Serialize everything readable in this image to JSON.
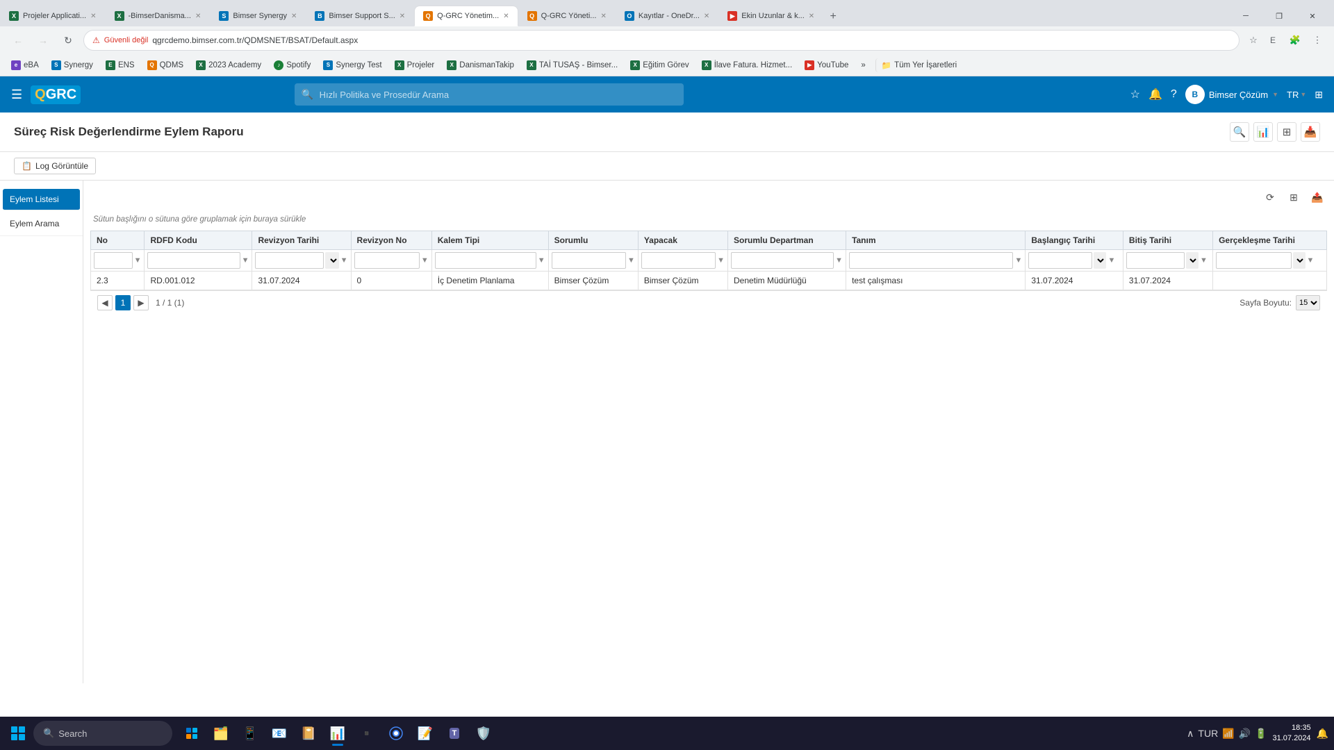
{
  "browser": {
    "tabs": [
      {
        "id": "tab1",
        "label": "Projeler Applicati...",
        "favicon_color": "#1d6f42",
        "active": false
      },
      {
        "id": "tab2",
        "label": "-BimserDanisma...",
        "favicon_color": "#1d6f42",
        "active": false
      },
      {
        "id": "tab3",
        "label": "Bimser Synergy",
        "favicon_color": "#0073b7",
        "active": false
      },
      {
        "id": "tab4",
        "label": "Bimser Support S...",
        "favicon_color": "#0073b7",
        "active": false
      },
      {
        "id": "tab5",
        "label": "Q-GRC Yönetim...",
        "favicon_color": "#e37400",
        "active": true
      },
      {
        "id": "tab6",
        "label": "Q-GRC Yöneti...",
        "favicon_color": "#e37400",
        "active": false
      },
      {
        "id": "tab7",
        "label": "Kayıtlar - OneDr...",
        "favicon_color": "#0073b7",
        "active": false
      },
      {
        "id": "tab8",
        "label": "Ekin Uzunlar & k...",
        "favicon_color": "#d93025",
        "active": false
      }
    ],
    "address": "qgrcdemo.bimser.com.tr/QDMSNET/BSAT/Default.aspx",
    "not_secure_label": "Güvenli değil"
  },
  "bookmarks": [
    {
      "label": "eBA",
      "color": "#6f42c1"
    },
    {
      "label": "Synergy",
      "color": "#0073b7"
    },
    {
      "label": "ENS",
      "color": "#1d6f42"
    },
    {
      "label": "QDMS",
      "color": "#e37400"
    },
    {
      "label": "2023 Academy",
      "color": "#1d6f42"
    },
    {
      "label": "Spotify",
      "color": "#1a7f37"
    },
    {
      "label": "Synergy Test",
      "color": "#0073b7"
    },
    {
      "label": "Projeler",
      "color": "#1d6f42"
    },
    {
      "label": "DanismanTakip",
      "color": "#1d6f42"
    },
    {
      "label": "TAİ TUSAŞ - Bimser...",
      "color": "#1d6f42"
    },
    {
      "label": "Eğitim Görev",
      "color": "#1d6f42"
    },
    {
      "label": "İlave Fatura. Hizmet...",
      "color": "#1d6f42"
    },
    {
      "label": "YouTube",
      "color": "#d93025"
    },
    {
      "label": "»",
      "color": "#555"
    },
    {
      "label": "Tüm Yer İşaretleri",
      "color": "#555"
    }
  ],
  "app": {
    "logo": "QGRC",
    "search_placeholder": "Hızlı Politika ve Prosedür Arama",
    "user_name": "Bimser Çözüm",
    "language": "TR"
  },
  "page": {
    "title": "Süreç Risk Değerlendirme Eylem Raporu",
    "toolbar": {
      "log_btn": "Log Görüntüle"
    },
    "group_hint": "Sütun başlığını o sütuna göre gruplamak için buraya sürükle",
    "sidebar": {
      "items": [
        {
          "label": "Eylem Listesi",
          "active": true
        },
        {
          "label": "Eylem Arama",
          "active": false
        }
      ]
    },
    "table": {
      "columns": [
        {
          "key": "no",
          "label": "No"
        },
        {
          "key": "rdfd_kodu",
          "label": "RDFD Kodu"
        },
        {
          "key": "revizyon_tarihi",
          "label": "Revizyon Tarihi"
        },
        {
          "key": "revizyon_no",
          "label": "Revizyon No"
        },
        {
          "key": "kalem_tipi",
          "label": "Kalem Tipi"
        },
        {
          "key": "sorumlu",
          "label": "Sorumlu"
        },
        {
          "key": "yapacak",
          "label": "Yapacak"
        },
        {
          "key": "sorumlu_departman",
          "label": "Sorumlu Departman"
        },
        {
          "key": "tanim",
          "label": "Tanım"
        },
        {
          "key": "baslangic_tarihi",
          "label": "Başlangıç Tarihi"
        },
        {
          "key": "bitis_tarihi",
          "label": "Bitiş Tarihi"
        },
        {
          "key": "gerceklestirme_tarihi",
          "label": "Gerçekleşme Tarihi"
        }
      ],
      "rows": [
        {
          "no": "2.3",
          "rdfd_kodu": "RD.001.012",
          "revizyon_tarihi": "31.07.2024",
          "revizyon_no": "0",
          "kalem_tipi": "İç Denetim Planlama",
          "sorumlu": "Bimser Çözüm",
          "yapacak": "Bimser Çözüm",
          "sorumlu_departman": "Denetim Müdürlüğü",
          "tanim": "test çalışması",
          "baslangic_tarihi": "31.07.2024",
          "bitis_tarihi": "31.07.2024",
          "gerceklestirme_tarihi": ""
        }
      ]
    },
    "pagination": {
      "current_page": "1",
      "page_info": "1 / 1 (1)",
      "page_size_label": "Sayfa Boyutu:",
      "page_size": "15"
    }
  },
  "taskbar": {
    "search_placeholder": "Search",
    "time": "18:35",
    "date": "31.07.2024",
    "language": "TUR",
    "apps": [
      "file-explorer",
      "chrome",
      "word",
      "excel",
      "teams",
      "outlook",
      "onenote",
      "notepad",
      "defender"
    ]
  }
}
